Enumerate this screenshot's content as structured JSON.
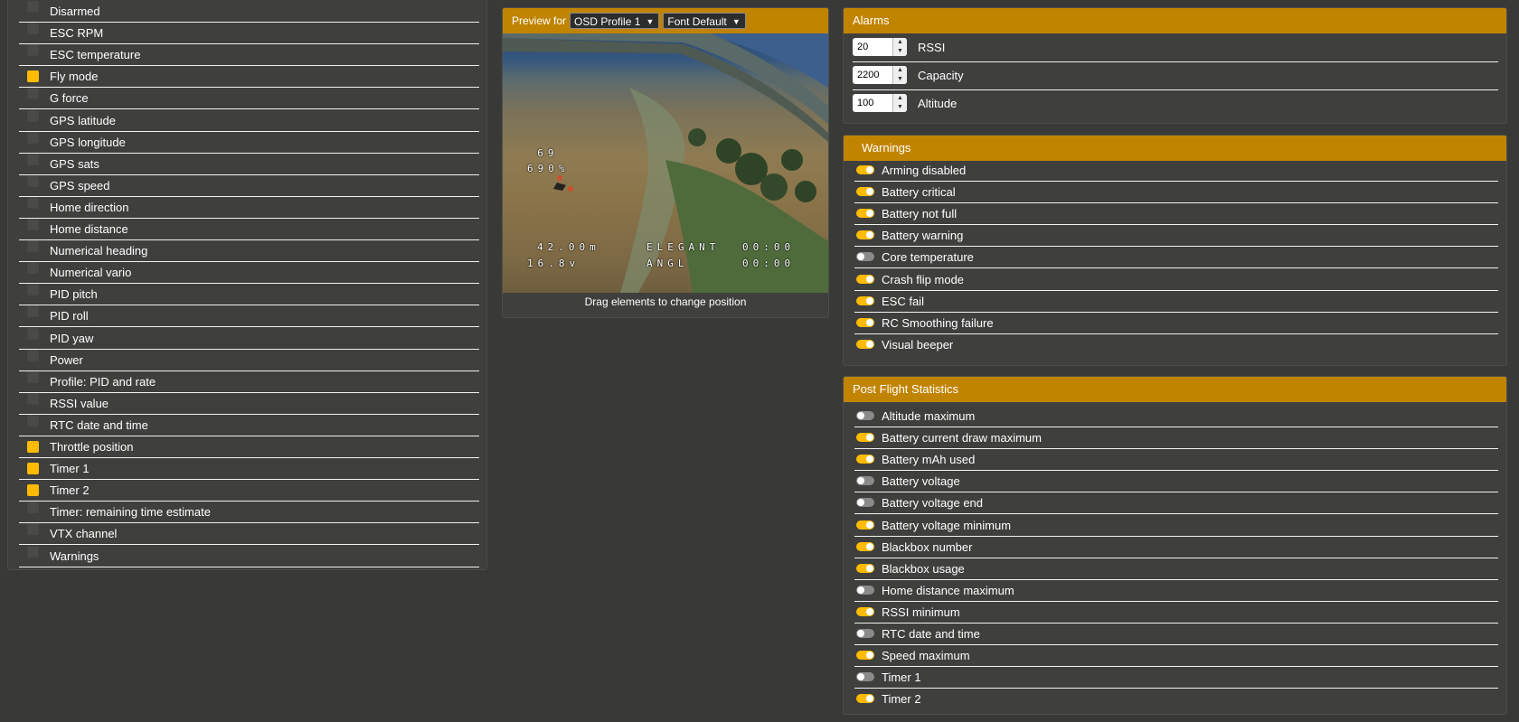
{
  "elements": {
    "items": [
      {
        "label": "Disarmed",
        "checked": false
      },
      {
        "label": "ESC RPM",
        "checked": false
      },
      {
        "label": "ESC temperature",
        "checked": false
      },
      {
        "label": "Fly mode",
        "checked": true
      },
      {
        "label": "G force",
        "checked": false
      },
      {
        "label": "GPS latitude",
        "checked": false
      },
      {
        "label": "GPS longitude",
        "checked": false
      },
      {
        "label": "GPS sats",
        "checked": false
      },
      {
        "label": "GPS speed",
        "checked": false
      },
      {
        "label": "Home direction",
        "checked": false
      },
      {
        "label": "Home distance",
        "checked": false
      },
      {
        "label": "Numerical heading",
        "checked": false
      },
      {
        "label": "Numerical vario",
        "checked": false
      },
      {
        "label": "PID pitch",
        "checked": false
      },
      {
        "label": "PID roll",
        "checked": false
      },
      {
        "label": "PID yaw",
        "checked": false
      },
      {
        "label": "Power",
        "checked": false
      },
      {
        "label": "Profile: PID and rate",
        "checked": false
      },
      {
        "label": "RSSI value",
        "checked": false
      },
      {
        "label": "RTC date and time",
        "checked": false
      },
      {
        "label": "Throttle position",
        "checked": true
      },
      {
        "label": "Timer 1",
        "checked": true
      },
      {
        "label": "Timer 2",
        "checked": true
      },
      {
        "label": "Timer: remaining time estimate",
        "checked": false
      },
      {
        "label": "VTX channel",
        "checked": false
      },
      {
        "label": "Warnings",
        "checked": false
      }
    ]
  },
  "preview": {
    "header_label": "Preview for",
    "profile_select": "OSD Profile 1",
    "font_select": "Font Default",
    "hint": "Drag elements to change position",
    "osd": {
      "line1": "  69",
      "line2": "690%",
      "altitude": "42.00m",
      "craft_name": "ELEGANT",
      "timer1": "00:00",
      "voltage": "16.8v",
      "mode": "ANGL",
      "timer2": "00:00"
    }
  },
  "alarms": {
    "title": "Alarms",
    "items": [
      {
        "value": "20",
        "label": "RSSI"
      },
      {
        "value": "2200",
        "label": "Capacity"
      },
      {
        "value": "100",
        "label": "Altitude"
      }
    ]
  },
  "warnings": {
    "title": "Warnings",
    "items": [
      {
        "label": "Arming disabled",
        "on": true
      },
      {
        "label": "Battery critical",
        "on": true
      },
      {
        "label": "Battery not full",
        "on": true
      },
      {
        "label": "Battery warning",
        "on": true
      },
      {
        "label": "Core temperature",
        "on": false
      },
      {
        "label": "Crash flip mode",
        "on": true
      },
      {
        "label": "ESC fail",
        "on": true
      },
      {
        "label": "RC Smoothing failure",
        "on": true
      },
      {
        "label": "Visual beeper",
        "on": true
      }
    ]
  },
  "stats": {
    "title": "Post Flight Statistics",
    "items": [
      {
        "label": "Altitude maximum",
        "on": false
      },
      {
        "label": "Battery current draw maximum",
        "on": true
      },
      {
        "label": "Battery mAh used",
        "on": true
      },
      {
        "label": "Battery voltage",
        "on": false
      },
      {
        "label": "Battery voltage end",
        "on": false
      },
      {
        "label": "Battery voltage minimum",
        "on": true
      },
      {
        "label": "Blackbox number",
        "on": true
      },
      {
        "label": "Blackbox usage",
        "on": true
      },
      {
        "label": "Home distance maximum",
        "on": false
      },
      {
        "label": "RSSI minimum",
        "on": true
      },
      {
        "label": "RTC date and time",
        "on": false
      },
      {
        "label": "Speed maximum",
        "on": true
      },
      {
        "label": "Timer 1",
        "on": false
      },
      {
        "label": "Timer 2",
        "on": true
      }
    ]
  },
  "colors": {
    "accent": "#c18400",
    "toggle_on": "#ffbb00",
    "background": "#393a38"
  }
}
